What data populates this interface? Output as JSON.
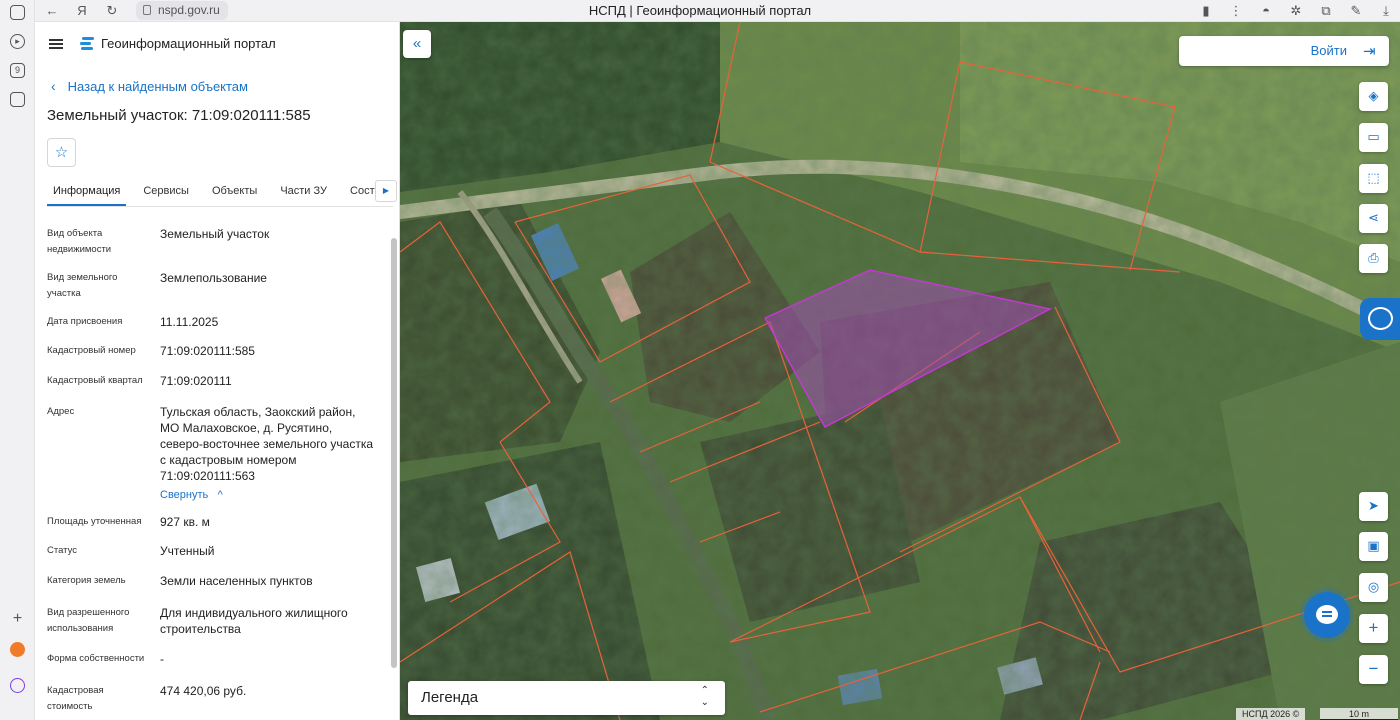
{
  "browser": {
    "url": "nspd.gov.ru",
    "tab_title": "НСПД | Геоинформационный портал"
  },
  "header": {
    "portal_title": "Геоинформационный портал",
    "back_link": "Назад к найденным объектам",
    "object_title": "Земельный участок: 71:09:020111:585"
  },
  "tabs": [
    {
      "label": "Информация"
    },
    {
      "label": "Сервисы"
    },
    {
      "label": "Объекты"
    },
    {
      "label": "Части ЗУ"
    },
    {
      "label": "Состав"
    }
  ],
  "properties": [
    {
      "key": "Вид объекта недвижимости",
      "value": "Земельный участок"
    },
    {
      "key": "Вид земельного участка",
      "value": "Землепользование"
    },
    {
      "key": "Дата присвоения",
      "value": "11.11.2025"
    },
    {
      "key": "Кадастровый номер",
      "value": "71:09:020111:585"
    },
    {
      "key": "Кадастровый квартал",
      "value": "71:09:020111"
    },
    {
      "key": "Адрес",
      "value": "Тульская область, Заокский район, МО Малаховское, д. Русятино, северо-восточнее земельного участка с кадастровым номером 71:09:020111:563"
    },
    {
      "key": "Площадь уточненная",
      "value": "927 кв. м"
    },
    {
      "key": "Статус",
      "value": "Учтенный"
    },
    {
      "key": "Категория земель",
      "value": "Земли населенных пунктов"
    },
    {
      "key": "Вид разрешенного использования",
      "value": "Для индивидуального жилищного строительства"
    },
    {
      "key": "Форма собственности",
      "value": "-"
    },
    {
      "key": "Кадастровая стоимость",
      "value": "474 420,06 руб."
    }
  ],
  "address_collapse": "Свернуть",
  "map": {
    "login_label": "Войти",
    "legend_label": "Легенда",
    "copyright": "НСПД 2026 ©",
    "scale_label": "10 m",
    "colors": {
      "boundary": "#e8623a",
      "selected_fill": "#a04fb3",
      "selected_stroke": "#c13ad0",
      "accent": "#1a73c8"
    },
    "tools": [
      "layers-icon",
      "ruler-icon",
      "select-area-icon",
      "share-icon",
      "print-icon",
      "locate-icon",
      "basemap-icon",
      "marker-icon",
      "zoom-in-icon",
      "zoom-out-icon"
    ]
  }
}
